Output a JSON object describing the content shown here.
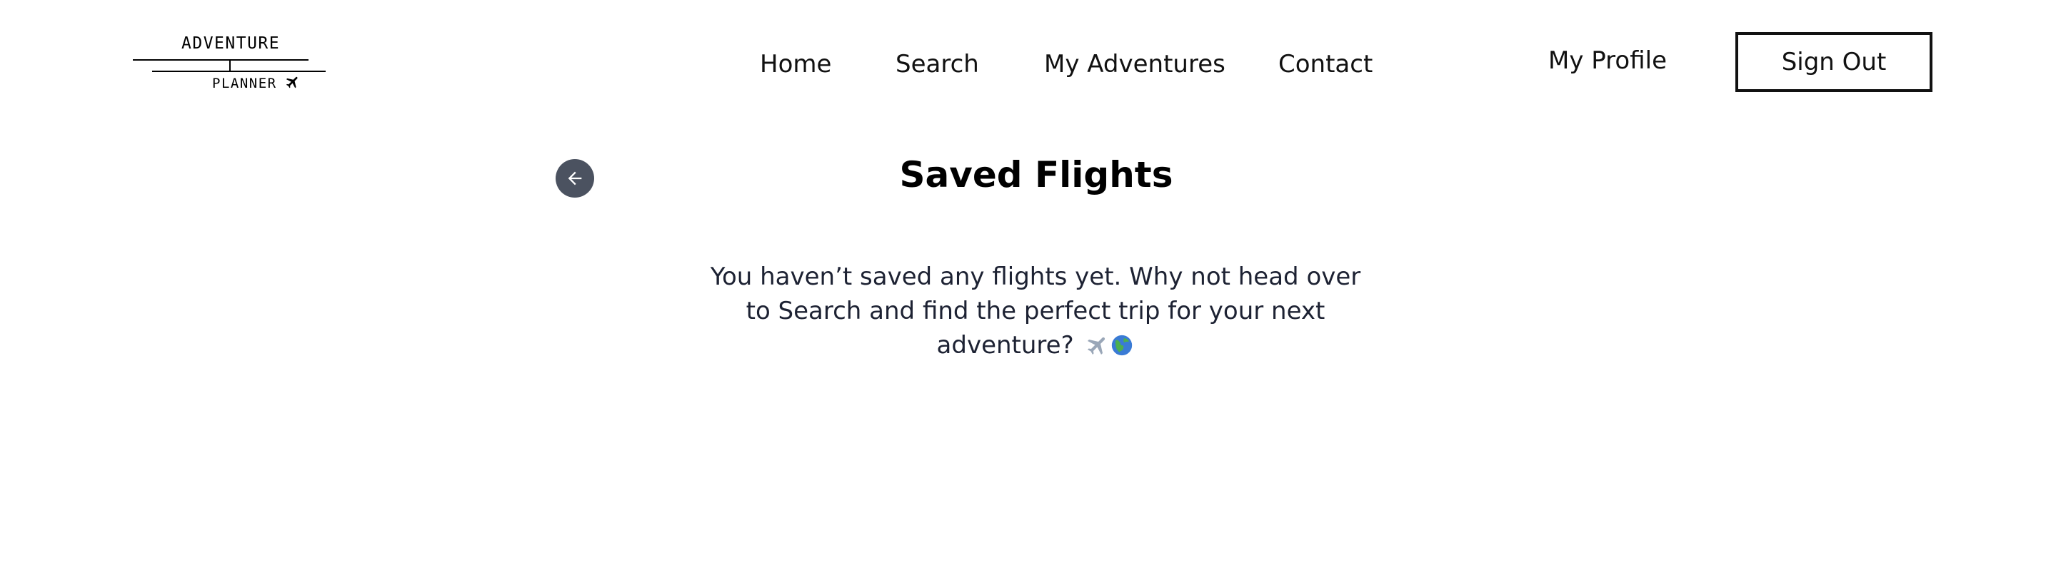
{
  "logo": {
    "top_text": "ADVENTURE",
    "bottom_text": "PLANNER",
    "icon": "airplane-icon"
  },
  "nav": {
    "home": "Home",
    "search": "Search",
    "my_adventures": "My Adventures",
    "contact": "Contact",
    "my_profile": "My Profile",
    "sign_out": "Sign Out"
  },
  "main": {
    "back_icon": "arrow-left-icon",
    "title": "Saved Flights",
    "empty_message": "You haven’t saved any flights yet. Why not head over to Search and find the perfect trip for your next adventure?",
    "emoji_icons": [
      "airplane-emoji-icon",
      "globe-emoji-icon"
    ]
  },
  "colors": {
    "back_button": "#4b5260",
    "text_dark": "#1d2233",
    "border": "#111111"
  }
}
